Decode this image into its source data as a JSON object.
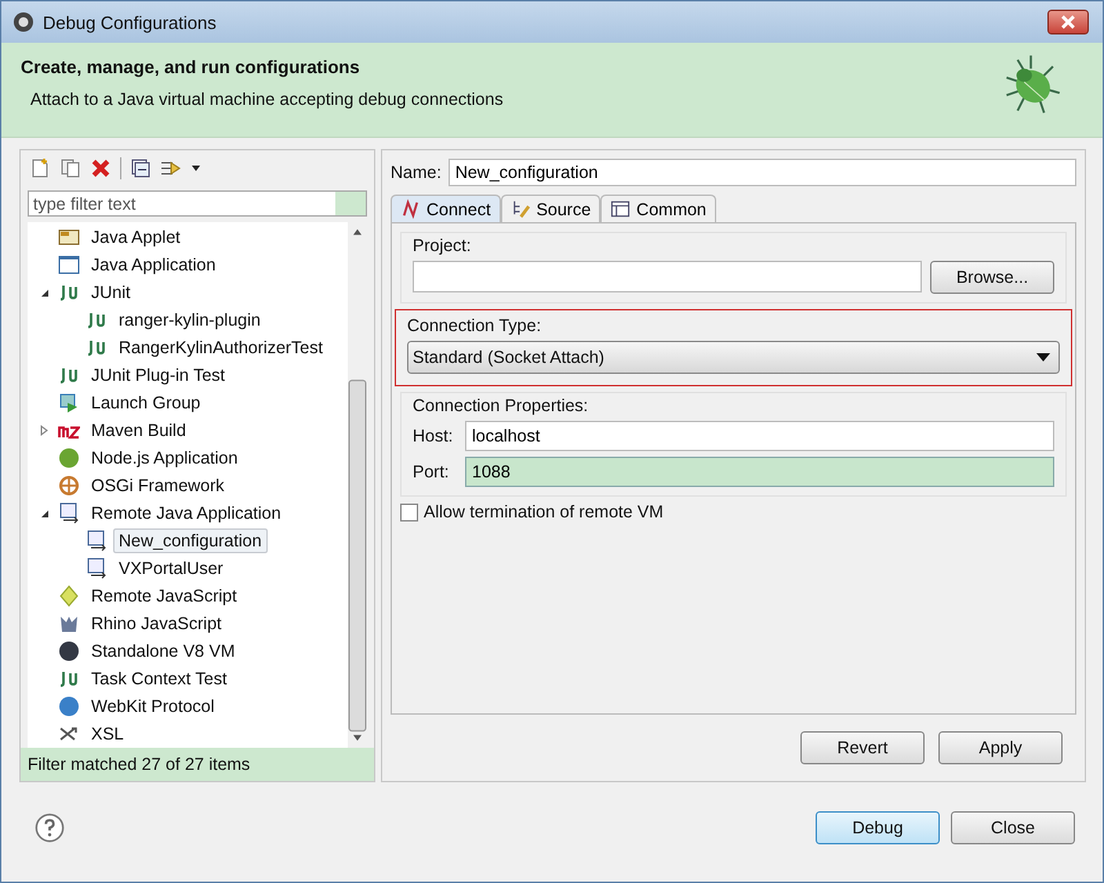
{
  "window": {
    "title": "Debug Configurations"
  },
  "header": {
    "title": "Create, manage, and run configurations",
    "message": "Attach to a Java virtual machine accepting debug connections"
  },
  "sidebar": {
    "filter": {
      "placeholder": "type filter text"
    },
    "items": [
      {
        "label": "Java Applet",
        "kind": "applet",
        "selected": false
      },
      {
        "label": "Java Application",
        "kind": "app",
        "selected": false
      },
      {
        "label": "JUnit",
        "kind": "junit",
        "selected": false,
        "expanded": true,
        "children": [
          {
            "label": "ranger-kylin-plugin",
            "kind": "junit",
            "selected": false
          },
          {
            "label": "RangerKylinAuthorizerTest",
            "kind": "junit",
            "selected": false
          }
        ]
      },
      {
        "label": "JUnit Plug-in Test",
        "kind": "junit",
        "selected": false
      },
      {
        "label": "Launch Group",
        "kind": "group",
        "selected": false
      },
      {
        "label": "Maven Build",
        "kind": "maven",
        "selected": false,
        "expanded": false
      },
      {
        "label": "Node.js Application",
        "kind": "node",
        "selected": false
      },
      {
        "label": "OSGi Framework",
        "kind": "osgi",
        "selected": false
      },
      {
        "label": "Remote Java Application",
        "kind": "remote",
        "selected": false,
        "expanded": true,
        "children": [
          {
            "label": "New_configuration",
            "kind": "remote",
            "selected": true
          },
          {
            "label": "VXPortalUser",
            "kind": "remote",
            "selected": false
          }
        ]
      },
      {
        "label": "Remote JavaScript",
        "kind": "remotejs",
        "selected": false
      },
      {
        "label": "Rhino JavaScript",
        "kind": "rhino",
        "selected": false
      },
      {
        "label": "Standalone V8 VM",
        "kind": "v8",
        "selected": false
      },
      {
        "label": "Task Context Test",
        "kind": "junit",
        "selected": false
      },
      {
        "label": "WebKit Protocol",
        "kind": "webkit",
        "selected": false
      },
      {
        "label": "XSL",
        "kind": "xsl",
        "selected": false
      }
    ],
    "status": "Filter matched 27 of 27 items"
  },
  "editor": {
    "name_label": "Name:",
    "name_value": "New_configuration",
    "tabs": [
      {
        "label": "Connect",
        "selected": true
      },
      {
        "label": "Source",
        "selected": false
      },
      {
        "label": "Common",
        "selected": false
      }
    ],
    "project": {
      "label": "Project:",
      "browse": "Browse..."
    },
    "connection_type": {
      "label": "Connection Type:",
      "value": "Standard (Socket Attach)"
    },
    "connection_properties": {
      "label": "Connection Properties:",
      "fields": [
        {
          "label": "Host:",
          "value": "localhost",
          "focused": false
        },
        {
          "label": "Port:",
          "value": "1088",
          "focused": true
        }
      ]
    },
    "allow_termination": {
      "label": "Allow termination of remote VM",
      "checked": false
    },
    "buttons": [
      "Revert",
      "Apply"
    ]
  },
  "footer": {
    "buttons": [
      {
        "label": "Debug",
        "default": true
      },
      {
        "label": "Close",
        "default": false
      }
    ]
  }
}
